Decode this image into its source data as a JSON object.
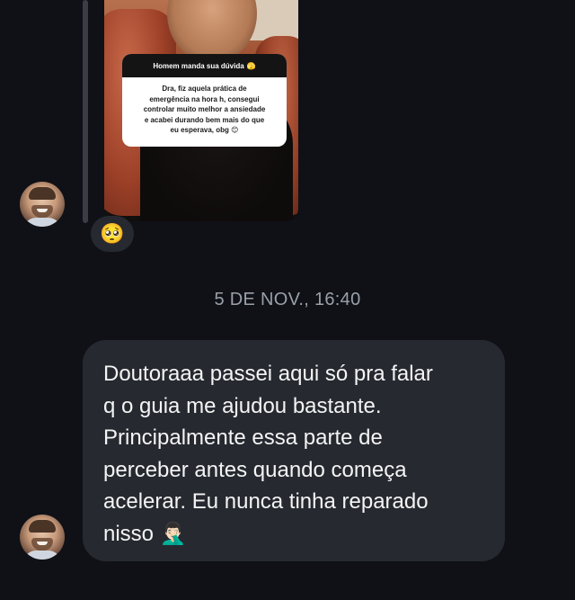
{
  "story_reply": {
    "question_header": "Homem manda sua dúvida",
    "question_header_emoji": "🫣",
    "question_lines": [
      "Dra, fiz aquela prática de",
      "emergência na hora h, consegui",
      "controlar muito melhor a ansiedade",
      "e acabei durando bem mais do que",
      "eu esperava, obg 😊"
    ],
    "reaction_emoji": "🥺"
  },
  "timestamp": "5 DE NOV., 16:40",
  "message": {
    "lines": [
      "Doutoraaa passei aqui só pra falar",
      "q o guia me ajudou bastante.",
      "Principalmente essa parte de",
      "perceber antes quando começa",
      "acelerar. Eu nunca tinha reparado",
      "nisso 🤦🏻‍♂️"
    ]
  },
  "colors": {
    "background": "#0f1117",
    "bubble": "#262930",
    "timestamp_text": "#9aa0a9"
  },
  "icons": {
    "sender_avatar": "profile-photo-avatar"
  }
}
